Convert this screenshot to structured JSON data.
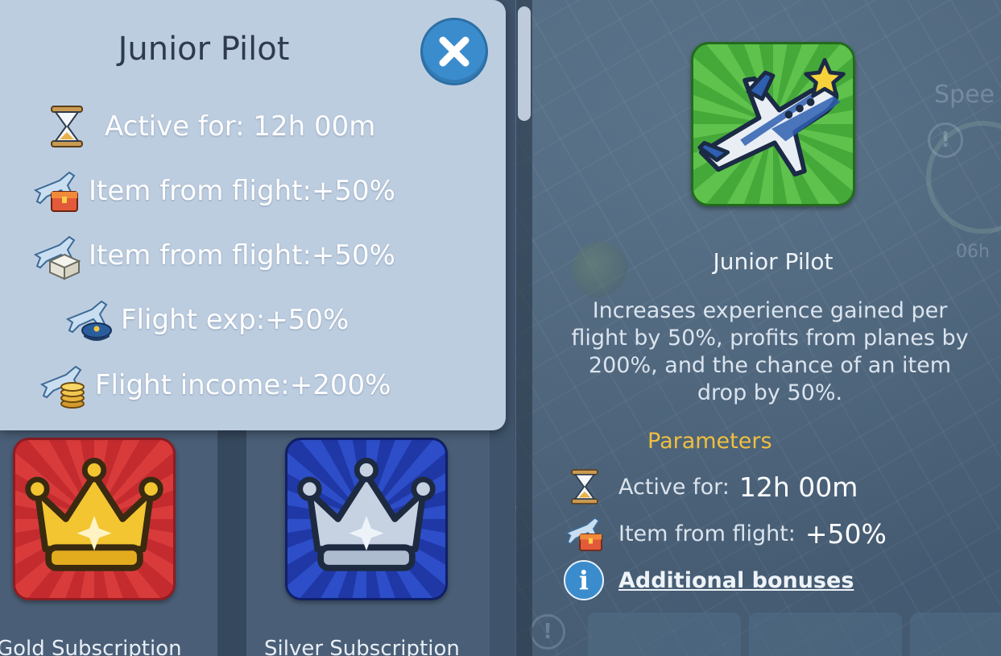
{
  "popup": {
    "title": "Junior Pilot",
    "close_icon": "close-icon",
    "stats": [
      {
        "icon": "hourglass-icon",
        "text": "Active for: 12h 00m"
      },
      {
        "icon": "plane-chest-icon",
        "text": "Item from flight:+50%"
      },
      {
        "icon": "plane-box-icon",
        "text": "Item from flight:+50%"
      },
      {
        "icon": "plane-pilot-cap-icon",
        "text": "Flight exp:+50%"
      },
      {
        "icon": "plane-coins-icon",
        "text": "Flight income:+200%"
      }
    ]
  },
  "catalog": {
    "items": [
      {
        "label": "Gold Subscription",
        "icon": "gold-crown-icon",
        "color": "#d93b3b"
      },
      {
        "label": "Silver Subscription",
        "icon": "silver-crown-icon",
        "color": "#2d4ec8"
      }
    ]
  },
  "info": {
    "icon": "plane-star-icon",
    "title": "Junior Pilot",
    "description": "Increases experience gained per flight by 50%, profits from planes by 200%, and the chance of an item drop by 50%.",
    "parameters_heading": "Parameters",
    "parameters": [
      {
        "icon": "hourglass-icon",
        "label": "Active for:",
        "value": "12h 00m"
      },
      {
        "icon": "plane-chest-icon",
        "label": "Item from flight:",
        "value": "+50%"
      }
    ],
    "more_link": "Additional bonuses",
    "info_icon_glyph": "i"
  },
  "background": {
    "speed_text": "Spee",
    "time_text": "06h",
    "alert_glyph": "!"
  },
  "colors": {
    "accent_blue": "#3b8ccd",
    "parameters_heading": "#f0bf3f",
    "popup_bg": "#bdcde0",
    "icon_green": "#5fc24c"
  }
}
